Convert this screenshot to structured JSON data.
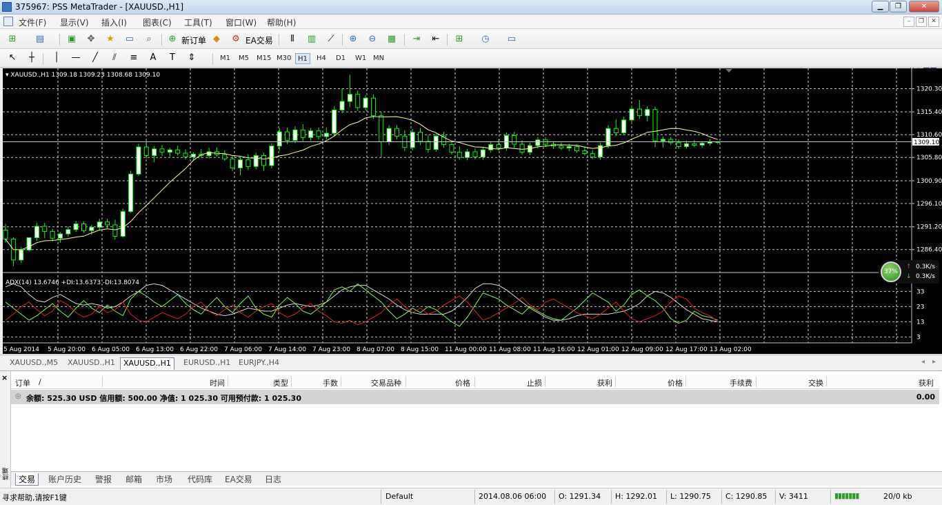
{
  "window": {
    "title": "375967: PSS MetaTrader - [XAUUSD.,H1]"
  },
  "menu": [
    "文件(F)",
    "显示(V)",
    "插入(I)",
    "图表(C)",
    "工具(T)",
    "窗口(W)",
    "帮助(H)"
  ],
  "toolbar": {
    "new_order": "新订单",
    "ea_trade": "EA交易"
  },
  "timeframes": [
    "M1",
    "M5",
    "M15",
    "M30",
    "H1",
    "H4",
    "D1",
    "W1",
    "MN"
  ],
  "active_timeframe": "H1",
  "search": {
    "placeholder": ""
  },
  "chart": {
    "header": "XAUUSD.,H1  1309.18 1309.23 1308.68 1309.10",
    "indicator_header": "ADX(14) 13.6746 +DI:13.6373 -DI:13.8074",
    "current_price": "1309.10",
    "price_labels": [
      "1320.30",
      "1315.40",
      "1310.60",
      "1305.80",
      "1300.90",
      "1296.10",
      "1291.20",
      "1286.40"
    ],
    "adx_labels": [
      "33",
      "23",
      "13",
      "3"
    ],
    "time_labels": [
      "5 Aug 2014",
      "5 Aug 20:00",
      "6 Aug 05:00",
      "6 Aug 13:00",
      "6 Aug 22:00",
      "7 Aug 06:00",
      "7 Aug 14:00",
      "7 Aug 23:00",
      "8 Aug 07:00",
      "8 Aug 15:00",
      "11 Aug 00:00",
      "11 Aug 08:00",
      "11 Aug 16:00",
      "12 Aug 01:00",
      "12 Aug 09:00",
      "12 Aug 17:00",
      "13 Aug 02:00"
    ],
    "colors": {
      "bg": "#000000",
      "grid": "#c8c8c8",
      "bull": "#ffffff",
      "bear": "#000000",
      "wick": "#00ff00",
      "ma": "#ffff80",
      "adx": "#d8d8d8",
      "plus_di": "#7cff2a",
      "minus_di": "#e02020"
    }
  },
  "chart_data": {
    "type": "candlestick",
    "series_name": "XAUUSD.,H1",
    "ylim": [
      1282,
      1324
    ],
    "ohlc": [
      [
        1290.5,
        1291.8,
        1287.9,
        1288.6
      ],
      [
        1288.6,
        1289.0,
        1282.9,
        1284.2
      ],
      [
        1284.2,
        1286.9,
        1283.6,
        1286.3
      ],
      [
        1286.3,
        1289.0,
        1286.0,
        1288.9
      ],
      [
        1288.9,
        1292.0,
        1288.2,
        1291.3
      ],
      [
        1291.3,
        1292.0,
        1288.8,
        1290.2
      ],
      [
        1290.2,
        1290.8,
        1288.1,
        1288.8
      ],
      [
        1288.8,
        1290.1,
        1287.8,
        1289.7
      ],
      [
        1289.7,
        1291.3,
        1289.1,
        1290.6
      ],
      [
        1290.6,
        1292.4,
        1290.1,
        1291.8
      ],
      [
        1291.8,
        1292.3,
        1290.0,
        1290.4
      ],
      [
        1290.4,
        1291.6,
        1289.5,
        1291.1
      ],
      [
        1291.1,
        1292.9,
        1290.5,
        1292.2
      ],
      [
        1292.2,
        1292.9,
        1290.9,
        1291.6
      ],
      [
        1291.6,
        1292.7,
        1288.5,
        1289.2
      ],
      [
        1289.2,
        1295.0,
        1288.9,
        1294.4
      ],
      [
        1294.4,
        1303.0,
        1294.1,
        1302.3
      ],
      [
        1302.3,
        1308.7,
        1301.9,
        1308.0
      ],
      [
        1308.0,
        1309.3,
        1305.6,
        1306.2
      ],
      [
        1306.2,
        1308.2,
        1304.8,
        1307.6
      ],
      [
        1307.6,
        1308.4,
        1306.1,
        1306.9
      ],
      [
        1306.9,
        1307.8,
        1306.0,
        1307.4
      ],
      [
        1307.4,
        1308.3,
        1306.2,
        1306.7
      ],
      [
        1306.7,
        1307.5,
        1305.4,
        1305.9
      ],
      [
        1305.9,
        1306.9,
        1305.1,
        1306.5
      ],
      [
        1306.5,
        1307.6,
        1305.8,
        1306.2
      ],
      [
        1306.2,
        1307.8,
        1305.6,
        1307.0
      ],
      [
        1307.0,
        1307.9,
        1306.0,
        1306.4
      ],
      [
        1306.4,
        1307.3,
        1305.1,
        1305.5
      ],
      [
        1305.5,
        1306.1,
        1302.9,
        1303.6
      ],
      [
        1303.6,
        1305.9,
        1302.0,
        1305.3
      ],
      [
        1305.3,
        1306.5,
        1303.2,
        1303.9
      ],
      [
        1303.9,
        1306.8,
        1303.3,
        1306.2
      ],
      [
        1306.2,
        1306.8,
        1303.0,
        1304.1
      ],
      [
        1304.1,
        1308.8,
        1303.5,
        1308.2
      ],
      [
        1308.2,
        1312.0,
        1307.2,
        1311.2
      ],
      [
        1311.2,
        1312.1,
        1308.6,
        1309.4
      ],
      [
        1309.4,
        1312.4,
        1308.8,
        1311.6
      ],
      [
        1311.6,
        1312.8,
        1309.2,
        1310.0
      ],
      [
        1310.0,
        1312.0,
        1309.3,
        1311.4
      ],
      [
        1311.4,
        1312.1,
        1309.6,
        1310.2
      ],
      [
        1310.2,
        1312.1,
        1309.6,
        1310.9
      ],
      [
        1310.9,
        1316.6,
        1310.3,
        1315.8
      ],
      [
        1315.8,
        1320.4,
        1315.1,
        1317.6
      ],
      [
        1317.6,
        1323.2,
        1316.4,
        1319.1
      ],
      [
        1319.1,
        1319.9,
        1315.6,
        1316.3
      ],
      [
        1316.3,
        1318.9,
        1315.7,
        1318.3
      ],
      [
        1318.3,
        1319.1,
        1313.9,
        1314.6
      ],
      [
        1314.6,
        1315.4,
        1305.8,
        1309.1
      ],
      [
        1309.1,
        1312.6,
        1308.4,
        1311.9
      ],
      [
        1311.9,
        1312.6,
        1309.6,
        1310.3
      ],
      [
        1310.3,
        1311.5,
        1307.2,
        1307.9
      ],
      [
        1307.9,
        1311.8,
        1307.3,
        1311.1
      ],
      [
        1311.1,
        1312.0,
        1308.4,
        1309.2
      ],
      [
        1309.2,
        1310.6,
        1306.8,
        1307.5
      ],
      [
        1307.5,
        1310.9,
        1307.0,
        1310.3
      ],
      [
        1310.3,
        1311.2,
        1307.8,
        1308.5
      ],
      [
        1308.5,
        1309.3,
        1306.4,
        1306.9
      ],
      [
        1306.9,
        1308.2,
        1305.3,
        1305.8
      ],
      [
        1305.8,
        1307.6,
        1305.2,
        1307.0
      ],
      [
        1307.0,
        1307.7,
        1305.4,
        1305.9
      ],
      [
        1305.9,
        1308.0,
        1305.3,
        1307.4
      ],
      [
        1307.4,
        1309.1,
        1306.8,
        1308.5
      ],
      [
        1308.5,
        1309.6,
        1307.2,
        1307.8
      ],
      [
        1307.8,
        1311.1,
        1307.2,
        1310.4
      ],
      [
        1310.4,
        1311.2,
        1307.8,
        1308.6
      ],
      [
        1308.6,
        1309.4,
        1306.4,
        1306.9
      ],
      [
        1306.9,
        1308.9,
        1306.3,
        1308.3
      ],
      [
        1308.3,
        1310.1,
        1307.7,
        1309.5
      ],
      [
        1309.5,
        1310.1,
        1308.0,
        1308.6
      ],
      [
        1308.6,
        1309.1,
        1307.6,
        1308.2
      ],
      [
        1308.2,
        1308.9,
        1307.4,
        1307.8
      ],
      [
        1307.8,
        1308.7,
        1307.1,
        1308.1
      ],
      [
        1308.1,
        1308.6,
        1306.8,
        1307.2
      ],
      [
        1307.2,
        1308.1,
        1306.2,
        1306.6
      ],
      [
        1306.6,
        1307.4,
        1305.5,
        1305.9
      ],
      [
        1305.9,
        1308.9,
        1305.3,
        1308.3
      ],
      [
        1308.3,
        1312.6,
        1307.7,
        1311.9
      ],
      [
        1311.9,
        1313.8,
        1310.3,
        1311.0
      ],
      [
        1311.0,
        1314.4,
        1310.5,
        1313.7
      ],
      [
        1313.7,
        1316.8,
        1312.9,
        1316.0
      ],
      [
        1316.0,
        1317.9,
        1313.9,
        1314.6
      ],
      [
        1314.6,
        1316.6,
        1313.4,
        1315.9
      ],
      [
        1315.9,
        1316.5,
        1308.0,
        1309.3
      ],
      [
        1309.3,
        1310.2,
        1307.9,
        1309.6
      ],
      [
        1309.6,
        1310.1,
        1308.4,
        1308.9
      ],
      [
        1308.9,
        1309.6,
        1307.6,
        1308.1
      ],
      [
        1308.1,
        1309.4,
        1307.7,
        1308.7
      ],
      [
        1308.7,
        1309.5,
        1308.0,
        1308.4
      ],
      [
        1308.4,
        1309.2,
        1307.9,
        1308.8
      ],
      [
        1308.8,
        1309.7,
        1308.3,
        1309.1
      ],
      [
        1309.1,
        1309.2,
        1308.6,
        1309.1
      ]
    ],
    "adx": [
      36,
      38,
      36,
      31,
      27,
      26,
      29,
      31,
      28,
      25,
      24,
      25,
      24,
      22,
      23,
      26,
      30,
      33,
      37,
      38,
      37,
      34,
      31,
      28,
      25,
      22,
      20,
      18,
      17,
      18,
      20,
      22,
      21,
      20,
      20,
      22,
      24,
      25,
      24,
      23,
      24,
      26,
      30,
      34,
      36,
      37,
      37,
      34,
      31,
      28,
      24,
      21,
      19,
      18,
      18,
      18,
      18,
      20,
      24,
      29,
      35,
      38,
      38,
      37,
      34,
      30,
      26,
      22,
      19,
      16,
      14,
      14,
      15,
      17,
      18,
      18,
      18,
      18,
      19,
      20,
      22,
      25,
      30,
      33,
      32,
      29,
      25,
      21,
      18,
      15,
      14,
      13
    ],
    "plus_di": [
      26,
      22,
      18,
      14,
      17,
      21,
      25,
      20,
      16,
      22,
      27,
      22,
      19,
      24,
      20,
      17,
      28,
      33,
      30,
      26,
      23,
      27,
      31,
      25,
      21,
      18,
      24,
      29,
      23,
      19,
      25,
      30,
      22,
      18,
      16,
      24,
      29,
      25,
      20,
      18,
      22,
      26,
      34,
      36,
      33,
      38,
      34,
      30,
      26,
      20,
      15,
      18,
      22,
      19,
      23,
      21,
      17,
      13,
      10,
      16,
      24,
      32,
      30,
      28,
      24,
      21,
      18,
      23,
      20,
      17,
      15,
      14,
      18,
      22,
      27,
      32,
      29,
      26,
      20,
      24,
      31,
      34,
      30,
      27,
      22,
      15,
      12,
      14,
      20,
      17,
      16,
      14
    ],
    "minus_di": [
      14,
      18,
      23,
      26,
      21,
      17,
      20,
      27,
      24,
      19,
      16,
      18,
      23,
      19,
      21,
      26,
      18,
      14,
      13,
      16,
      19,
      17,
      15,
      18,
      23,
      26,
      20,
      17,
      21,
      24,
      19,
      16,
      20,
      23,
      25,
      19,
      16,
      18,
      22,
      25,
      20,
      17,
      13,
      12,
      14,
      11,
      13,
      16,
      19,
      24,
      28,
      23,
      19,
      22,
      18,
      20,
      24,
      27,
      30,
      26,
      20,
      14,
      16,
      19,
      22,
      25,
      29,
      24,
      21,
      26,
      28,
      25,
      22,
      19,
      17,
      15,
      18,
      22,
      26,
      20,
      15,
      13,
      15,
      17,
      20,
      26,
      30,
      28,
      22,
      19,
      17,
      13
    ]
  },
  "chart_tabs": [
    "XAUUSD.,M5",
    "XAUUSD.,H1",
    "XAUUSD.,H1",
    "EURUSD.,H1",
    "EURJPY.,H4"
  ],
  "terminal": {
    "close": "×",
    "side_label": "终端",
    "columns": [
      "订单",
      "/",
      "时间",
      "类型",
      "手数",
      "交易品种",
      "价格",
      "止损",
      "获利",
      "价格",
      "手续费",
      "交换",
      "获利"
    ],
    "balance_text": "余额: 525.30 USD  信用额: 500.00  净值: 1 025.30  可用预付款: 1 025.30",
    "balance_profit": "0.00",
    "tabs": [
      "交易",
      "账户历史",
      "警报",
      "邮箱",
      "市场",
      "代码库",
      "EA交易",
      "日志"
    ]
  },
  "net_widget": {
    "percent": "37%",
    "up": "0.3K/s",
    "down": "0.3K/s"
  },
  "status": {
    "help": "寻求帮助,请按F1键",
    "profile": "Default",
    "time": "2014.08.06 06:00",
    "open": "O: 1291.34",
    "high": "H: 1292.01",
    "low": "L: 1290.75",
    "close": "C: 1290.85",
    "volume": "V: 3411",
    "traffic": "20/0 kb"
  }
}
